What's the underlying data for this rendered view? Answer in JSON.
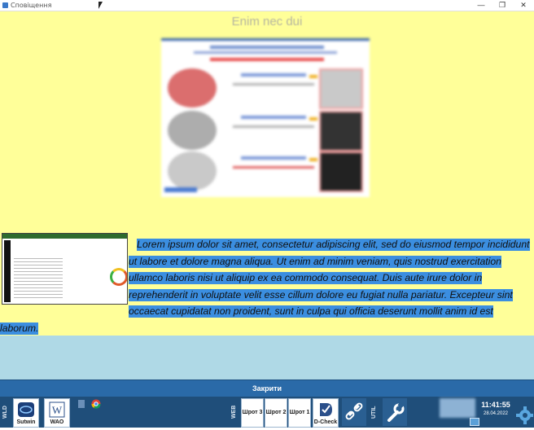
{
  "window": {
    "title": "Сповіщення",
    "minimize": "—",
    "maximize": "❐",
    "close": "✕"
  },
  "heading": "Enim nec dui",
  "paragraph": "Lorem ipsum dolor sit amet, consectetur adipiscing elit, sed do eiusmod tempor incididunt ut labore et dolore magna aliqua. Ut enim ad minim veniam, quis nostrud exercitation ullamco laboris nisi ut aliquip ex ea commodo consequat. Duis aute irure dolor in reprehenderit in voluptate velit esse cillum dolore eu fugiat nulla pariatur. Excepteur sint occaecat cupidatat non proident, sunt in culpa qui officia deserunt mollit anim id est laborum.",
  "close_bar": "Закрити",
  "colors": {
    "content_bg": "#ffff99",
    "lower_bg": "#afd9e6",
    "selection": "#3b8ee0",
    "taskbar": "#1f4e7a"
  },
  "taskbar": {
    "left_label": "WLD",
    "apps": [
      {
        "label": "Sutwin",
        "icon": "sutwin-icon"
      },
      {
        "label": "WAO",
        "icon": "document-w-icon"
      }
    ],
    "web_label": "WEB",
    "web_buttons": [
      "Шрот 3",
      "Шрот 2",
      "Шрот 1"
    ],
    "dcheck_label": "D-Check",
    "util_label": "UTIL",
    "time": "11:41:55",
    "date": "28.04.2022"
  }
}
